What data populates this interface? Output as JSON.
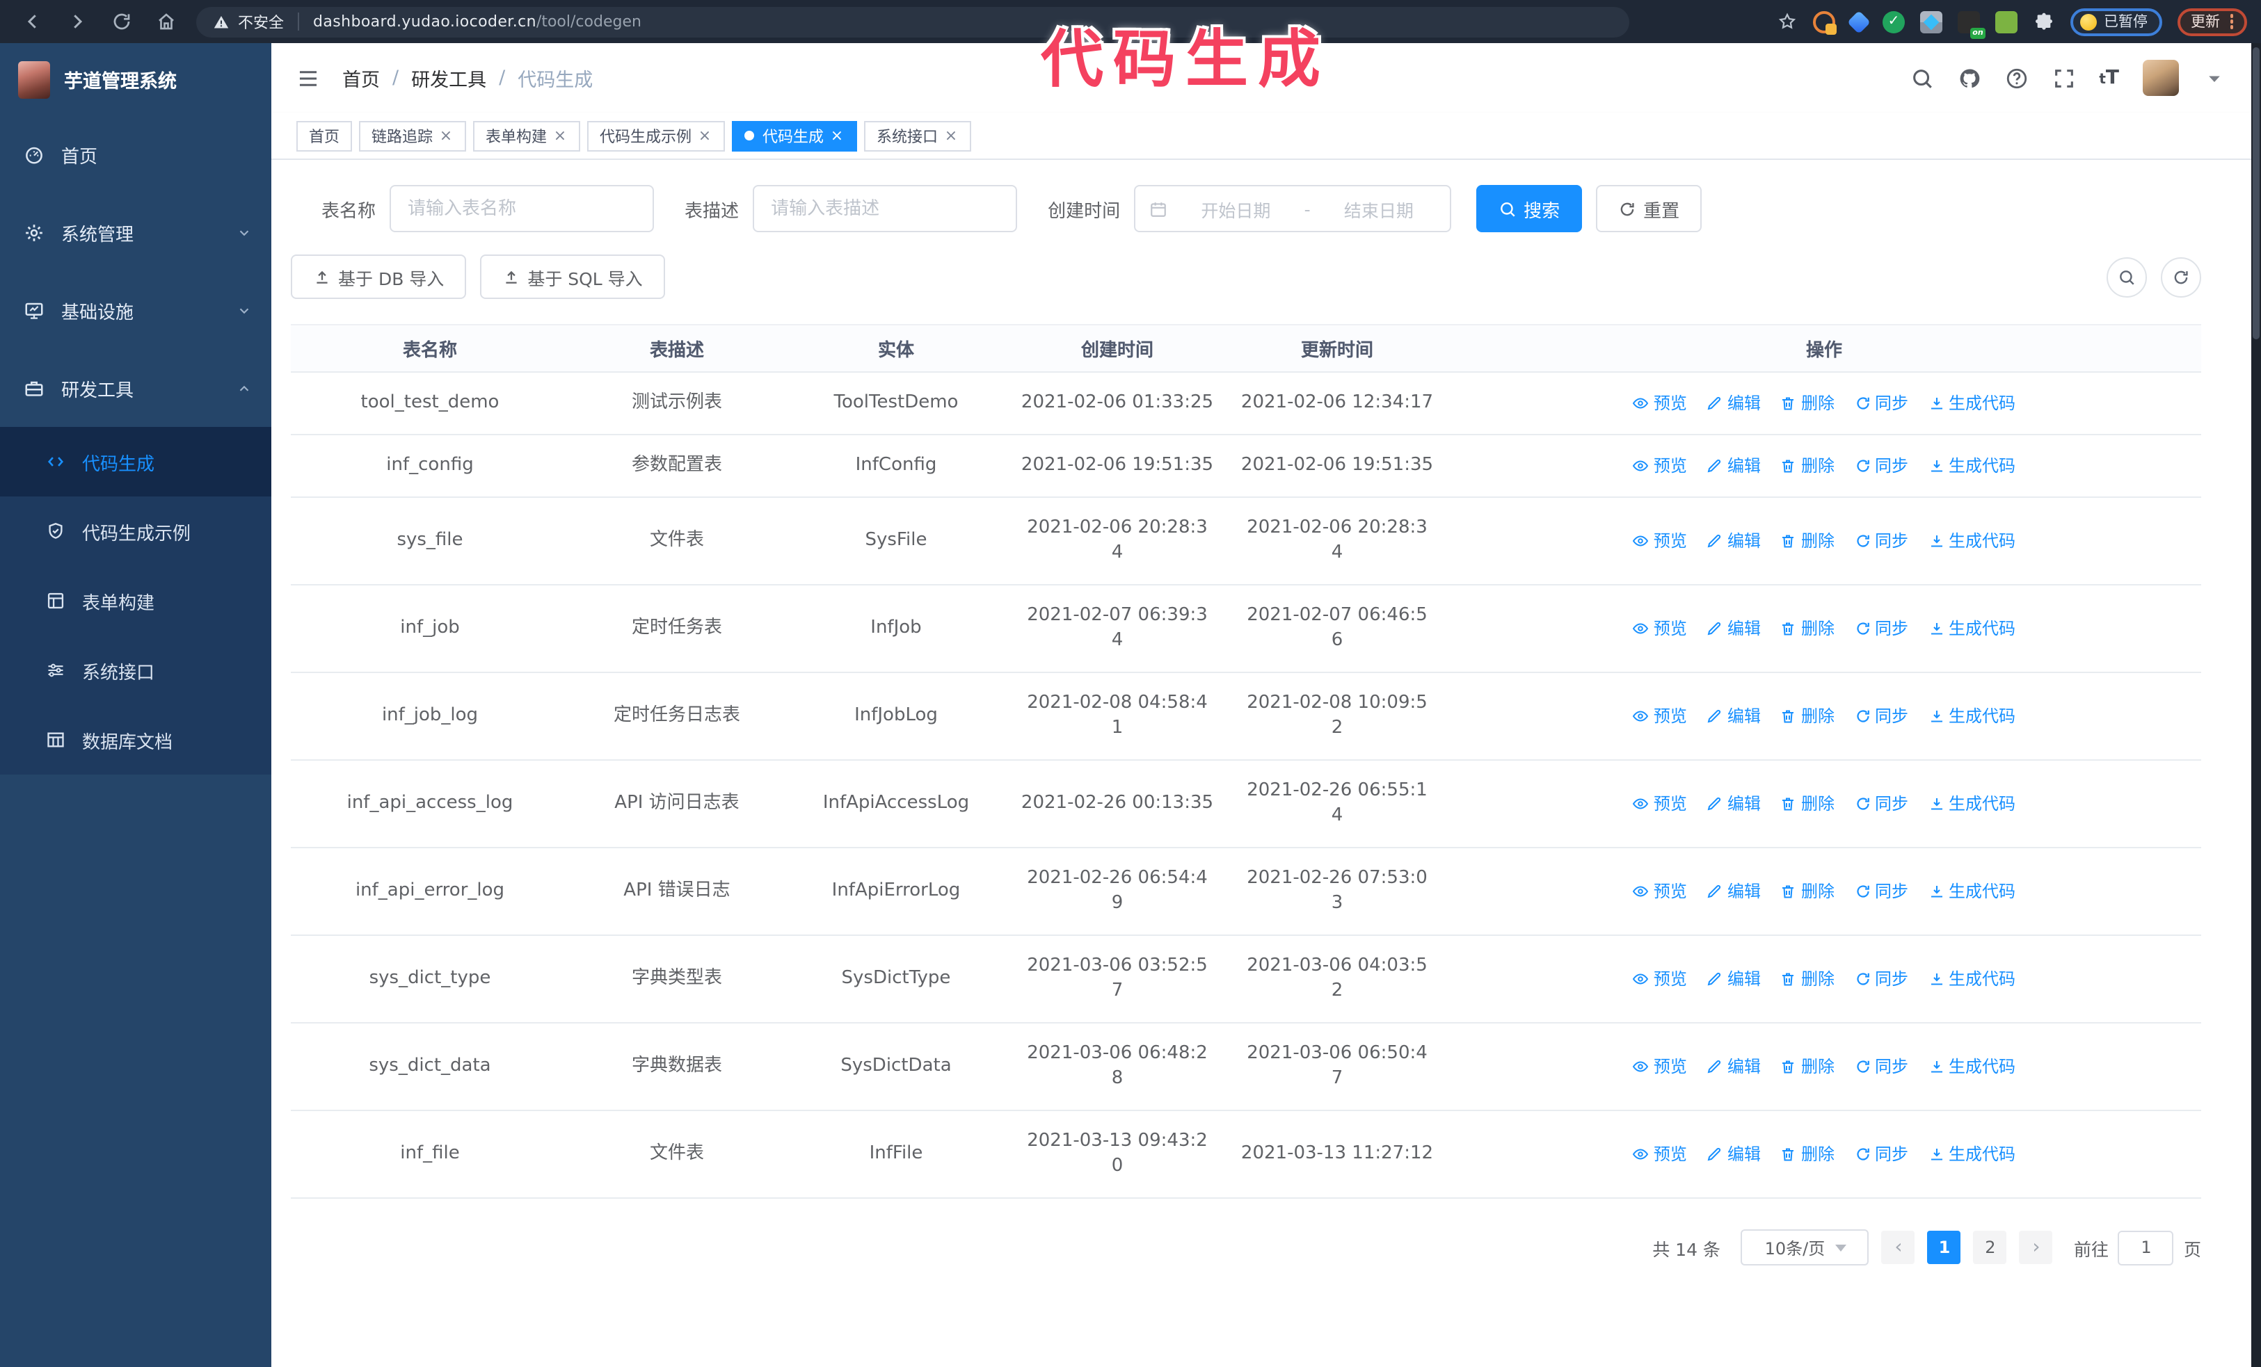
{
  "colors": {
    "accent": "#1890ff",
    "annotation": "#f4415f",
    "sidebar_bg": "#254569"
  },
  "browser": {
    "security_label": "不安全",
    "url_host": "dashboard.yudao.iocoder.cn",
    "url_path": "/tool/codegen",
    "extension_badge": "on",
    "paused_badge": "已暂停",
    "update_button": "更新"
  },
  "annotation": {
    "text": "代码生成"
  },
  "app": {
    "title": "芋道管理系统"
  },
  "breadcrumb": {
    "separator": "/",
    "items": [
      {
        "label": "首页"
      },
      {
        "label": "研发工具"
      },
      {
        "label": "代码生成"
      }
    ]
  },
  "sidebar": {
    "items": [
      {
        "label": "首页"
      },
      {
        "label": "系统管理"
      },
      {
        "label": "基础设施"
      },
      {
        "label": "研发工具"
      }
    ],
    "submenu": [
      {
        "label": "代码生成"
      },
      {
        "label": "代码生成示例"
      },
      {
        "label": "表单构建"
      },
      {
        "label": "系统接口"
      },
      {
        "label": "数据库文档"
      }
    ]
  },
  "tags": [
    {
      "label": "首页"
    },
    {
      "label": "链路追踪"
    },
    {
      "label": "表单构建"
    },
    {
      "label": "代码生成示例"
    },
    {
      "label": "代码生成"
    },
    {
      "label": "系统接口"
    }
  ],
  "icons": {
    "close": "×",
    "prev": "‹",
    "next": "›"
  },
  "search_form": {
    "table_name_label": "表名称",
    "table_name_placeholder": "请输入表名称",
    "table_desc_label": "表描述",
    "table_desc_placeholder": "请输入表描述",
    "create_time_label": "创建时间",
    "start_placeholder": "开始日期",
    "separator": "-",
    "end_placeholder": "结束日期",
    "search_label": "搜索",
    "reset_label": "重置"
  },
  "toolbar": {
    "import_db_label": "基于 DB 导入",
    "import_sql_label": "基于 SQL 导入"
  },
  "table": {
    "columns": [
      "表名称",
      "表描述",
      "实体",
      "创建时间",
      "更新时间",
      "操作"
    ],
    "actions": [
      "预览",
      "编辑",
      "删除",
      "同步",
      "生成代码"
    ],
    "rows": [
      {
        "name": "tool_test_demo",
        "desc": "测试示例表",
        "entity": "ToolTestDemo",
        "create_time": "2021-02-06 01:33:25",
        "update_time": "2021-02-06 12:34:17"
      },
      {
        "name": "inf_config",
        "desc": "参数配置表",
        "entity": "InfConfig",
        "create_time": "2021-02-06 19:51:35",
        "update_time": "2021-02-06 19:51:35"
      },
      {
        "name": "sys_file",
        "desc": "文件表",
        "entity": "SysFile",
        "create_time": "2021-02-06 20:28:3\n4",
        "update_time": "2021-02-06 20:28:3\n4"
      },
      {
        "name": "inf_job",
        "desc": "定时任务表",
        "entity": "InfJob",
        "create_time": "2021-02-07 06:39:3\n4",
        "update_time": "2021-02-07 06:46:5\n6"
      },
      {
        "name": "inf_job_log",
        "desc": "定时任务日志表",
        "entity": "InfJobLog",
        "create_time": "2021-02-08 04:58:4\n1",
        "update_time": "2021-02-08 10:09:5\n2"
      },
      {
        "name": "inf_api_access_log",
        "desc": "API 访问日志表",
        "entity": "InfApiAccessLog",
        "create_time": "2021-02-26 00:13:35",
        "update_time": "2021-02-26 06:55:1\n4"
      },
      {
        "name": "inf_api_error_log",
        "desc": "API 错误日志",
        "entity": "InfApiErrorLog",
        "create_time": "2021-02-26 06:54:4\n9",
        "update_time": "2021-02-26 07:53:0\n3"
      },
      {
        "name": "sys_dict_type",
        "desc": "字典类型表",
        "entity": "SysDictType",
        "create_time": "2021-03-06 03:52:5\n7",
        "update_time": "2021-03-06 04:03:5\n2"
      },
      {
        "name": "sys_dict_data",
        "desc": "字典数据表",
        "entity": "SysDictData",
        "create_time": "2021-03-06 06:48:2\n8",
        "update_time": "2021-03-06 06:50:4\n7"
      },
      {
        "name": "inf_file",
        "desc": "文件表",
        "entity": "InfFile",
        "create_time": "2021-03-13 09:43:2\n0",
        "update_time": "2021-03-13 11:27:12"
      }
    ]
  },
  "pagination": {
    "total_label": "共 14 条",
    "page_size": "10条/页",
    "pages": [
      "1",
      "2"
    ],
    "active_page": "1",
    "goto_label": "前往",
    "goto_value": "1",
    "page_suffix": "页"
  }
}
